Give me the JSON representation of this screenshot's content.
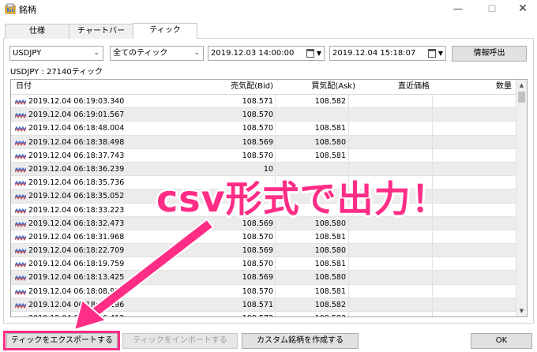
{
  "window": {
    "title": "銘柄"
  },
  "tabs": [
    {
      "label": "仕様"
    },
    {
      "label": "チャートバー"
    },
    {
      "label": "ティック"
    }
  ],
  "filters": {
    "symbol": "USDJPY",
    "tick_type": "全てのティック",
    "start_datetime": "2019.12.03 14:00:00",
    "end_datetime": "2019.12.04 15:18:07",
    "request_button": "情報呼出"
  },
  "summary": "USDJPY : 27140ティック",
  "table": {
    "columns": [
      "日付",
      "売気配(Bid)",
      "買気配(Ask)",
      "直近価格",
      "数量"
    ],
    "rows": [
      [
        "2019.12.04 06:19:03.340",
        "108.571",
        "108.582"
      ],
      [
        "2019.12.04 06:19:01.567",
        "108.570",
        ""
      ],
      [
        "2019.12.04 06:18:48.004",
        "108.570",
        "108.581"
      ],
      [
        "2019.12.04 06:18:38.498",
        "108.569",
        "108.580"
      ],
      [
        "2019.12.04 06:18:37.743",
        "108.570",
        "108.581"
      ],
      [
        "2019.12.04 06:18:36.239",
        "10",
        ""
      ],
      [
        "2019.12.04 06:18:35.736",
        "",
        ""
      ],
      [
        "2019.12.04 06:18:35.052",
        "",
        ""
      ],
      [
        "2019.12.04 06:18:33.223",
        "",
        ""
      ],
      [
        "2019.12.04 06:18:32.473",
        "108.569",
        "108.580"
      ],
      [
        "2019.12.04 06:18:31.968",
        "108.570",
        "108.581"
      ],
      [
        "2019.12.04 06:18:22.709",
        "108.569",
        "108.580"
      ],
      [
        "2019.12.04 06:18:19.759",
        "108.570",
        "108.581"
      ],
      [
        "2019.12.04 06:18:13.425",
        "108.569",
        "108.580"
      ],
      [
        "2019.12.04 06:18:08.913",
        "108.570",
        "108.581"
      ],
      [
        "2019.12.04 06:18:07.196",
        "108.571",
        "108.582"
      ],
      [
        "2019.12.04 06:18:06.412",
        "108.572",
        "108.583"
      ]
    ]
  },
  "footer": {
    "export_button": "ティックをエクスポートする",
    "import_button": "ティックをインポートする",
    "custom_symbol_button": "カスタム銘柄を作成する",
    "ok_button": "OK"
  },
  "annotation": {
    "text": "csv形式で出力！",
    "color": "#ff2d86"
  },
  "icons": [
    "app-icon",
    "minimize-icon",
    "maximize-icon",
    "close-icon",
    "calendar-icon",
    "tick-wave-icon",
    "dropdown-arrow-icon"
  ]
}
